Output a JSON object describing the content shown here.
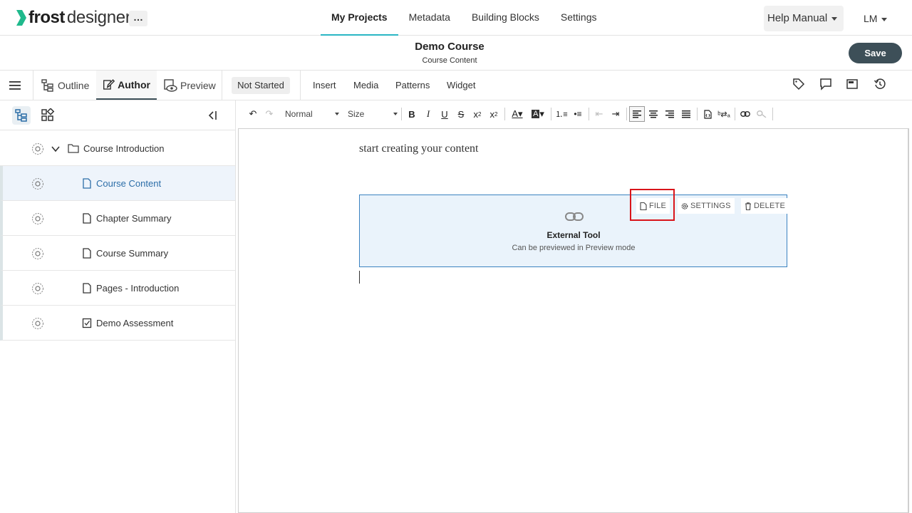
{
  "app": {
    "logo_bold": "frost",
    "logo_light": "designer",
    "more_label": "…"
  },
  "nav": {
    "items": [
      {
        "label": "My Projects",
        "active": true
      },
      {
        "label": "Metadata",
        "active": false
      },
      {
        "label": "Building Blocks",
        "active": false
      },
      {
        "label": "Settings",
        "active": false
      }
    ],
    "help_label": "Help Manual",
    "user_initials": "LM"
  },
  "course": {
    "title": "Demo Course",
    "subtitle": "Course Content",
    "save_label": "Save"
  },
  "modes": {
    "outline": "Outline",
    "author": "Author",
    "preview": "Preview",
    "active": "Author",
    "status": "Not Started"
  },
  "menu": {
    "insert": "Insert",
    "media": "Media",
    "patterns": "Patterns",
    "widget": "Widget"
  },
  "toolbar": {
    "format_select": "Normal",
    "size_select": "Size"
  },
  "tree": {
    "root": "Course Introduction",
    "items": [
      {
        "label": "Course Content",
        "icon": "page-icon",
        "selected": true
      },
      {
        "label": "Chapter Summary",
        "icon": "page-icon",
        "selected": false
      },
      {
        "label": "Course Summary",
        "icon": "page-icon",
        "selected": false
      },
      {
        "label": "Pages - Introduction",
        "icon": "page-icon",
        "selected": false
      },
      {
        "label": "Demo Assessment",
        "icon": "checkbox-icon",
        "selected": false
      }
    ]
  },
  "editor": {
    "placeholder_text": "start creating your content",
    "block": {
      "title": "External Tool",
      "subtitle": "Can be previewed in Preview mode",
      "file_label": "FILE",
      "settings_label": "SETTINGS",
      "delete_label": "DELETE"
    }
  },
  "colors": {
    "accent": "#2ab6c4",
    "save_bg": "#3d4f58",
    "selection": "#eef4fb",
    "block_border": "#3a82c0",
    "highlight": "#d9151b"
  }
}
